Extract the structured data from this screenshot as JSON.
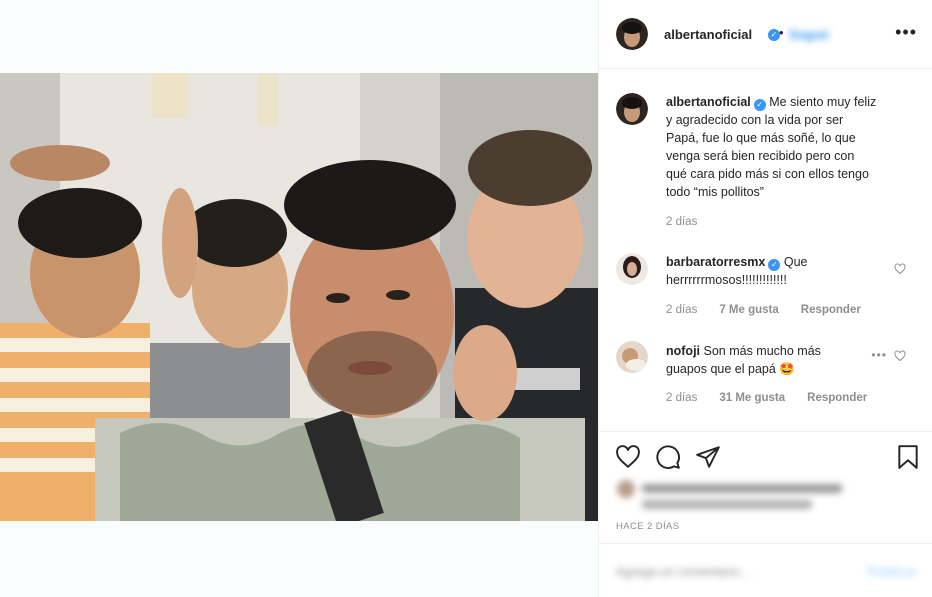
{
  "post": {
    "author": "albertanoficial",
    "follow_label": "Seguir",
    "separator": "•",
    "more_label": "•••"
  },
  "caption": {
    "username": "albertanoficial",
    "text": "Me siento muy feliz y agradecido con la vida por ser Papá, fue lo que más soñé, lo que venga será bien recibido pero con qué cara pido más si con ellos tengo todo “mis pollitos”",
    "time": "2 días"
  },
  "comments": [
    {
      "username": "barbaratorresmx",
      "verified": true,
      "text": "Que herrrrrrmosos!!!!!!!!!!!!!",
      "time": "2 días",
      "likes": "7 Me gusta",
      "reply_label": "Responder"
    },
    {
      "username": "nofoji",
      "verified": false,
      "text": "Son más mucho más guapos que el papá 🤩",
      "time": "2 días",
      "likes": "31 Me gusta",
      "reply_label": "Responder",
      "more_label": "•••"
    }
  ],
  "actions": {
    "icons": [
      "heart-icon",
      "comment-icon",
      "share-icon",
      "bookmark-icon"
    ]
  },
  "footer": {
    "time_ago": "HACE 2 DÍAS",
    "comment_placeholder": "Agrega un comentario...",
    "post_label": "Publicar"
  },
  "colors": {
    "link_blue": "#3897f0",
    "muted": "#8e8e8e",
    "text": "#262626",
    "border": "#efefef"
  }
}
